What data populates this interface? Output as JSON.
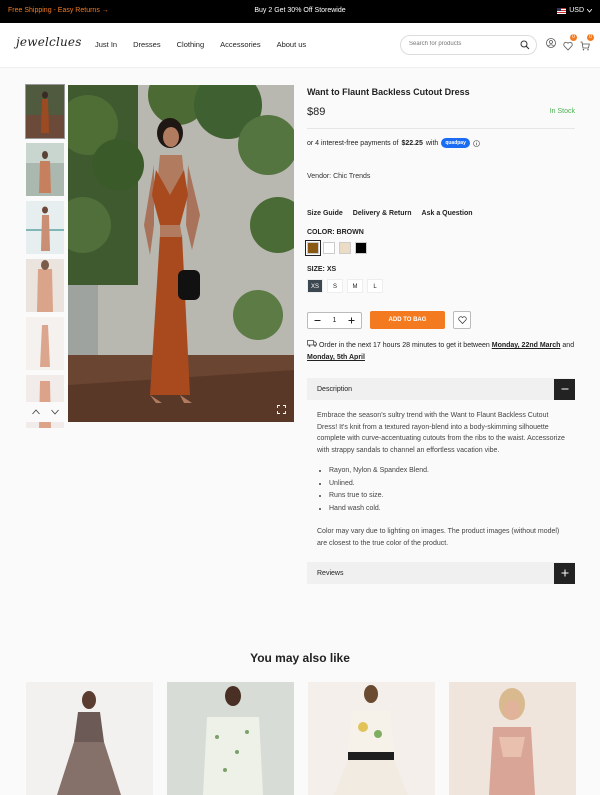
{
  "topbar": {
    "left_text": "Free Shipping - Easy Returns →",
    "center_text": "Buy 2 Get 30% Off Storewide",
    "currency": "USD"
  },
  "header": {
    "logo": "jewelclues",
    "nav": [
      "Just In",
      "Dresses",
      "Clothing",
      "Accessories",
      "About us"
    ],
    "search_placeholder": "Search for products",
    "wishlist_count": "0",
    "cart_count": "0"
  },
  "product": {
    "title": "Want to Flaunt Backless Cutout Dress",
    "price": "$89",
    "stock": "In Stock",
    "installments_prefix": "or 4 interest-free payments of",
    "installments_amount": "$22.25",
    "installments_with": "with",
    "sezzle_label": "quadpay",
    "vendor": "Vendor: Chic Trends",
    "links": [
      "Size Guide",
      "Delivery & Return",
      "Ask a Question"
    ],
    "color_label": "COLOR: BROWN",
    "colors": [
      "#8a5a12",
      "#ffffff",
      "#ecdcc6",
      "#000000"
    ],
    "size_label": "SIZE: XS",
    "sizes": [
      "XS",
      "S",
      "M",
      "L"
    ],
    "selected_size": "XS",
    "quantity": "1",
    "add_to_bag": "ADD TO BAG",
    "delivery_text_1": "Order in the next 17 hours 28 minutes to get it between",
    "delivery_date_1": "Monday, 22nd March",
    "delivery_and": "and",
    "delivery_date_2": "Monday, 5th April",
    "description_title": "Description",
    "description": "Embrace the season's sultry trend with the Want to Flaunt Backless Cutout Dress! It's knit from a textured rayon-blend into a body-skimming silhouette complete with curve-accentuating cutouts from the ribs to the waist. Accessorize with strappy sandals to channel an effortless vacation vibe.",
    "bullets": [
      "Rayon, Nylon & Spandex Blend.",
      "Unlined.",
      "Runs true to size.",
      "Hand wash cold."
    ],
    "color_note": "Color may vary due to lighting on images. The product images (without model) are closest to the true color of the product.",
    "reviews_title": "Reviews"
  },
  "related": {
    "title": "You may also like"
  },
  "colors": {
    "accent": "#f47a20",
    "stock_green": "#4caf50"
  }
}
